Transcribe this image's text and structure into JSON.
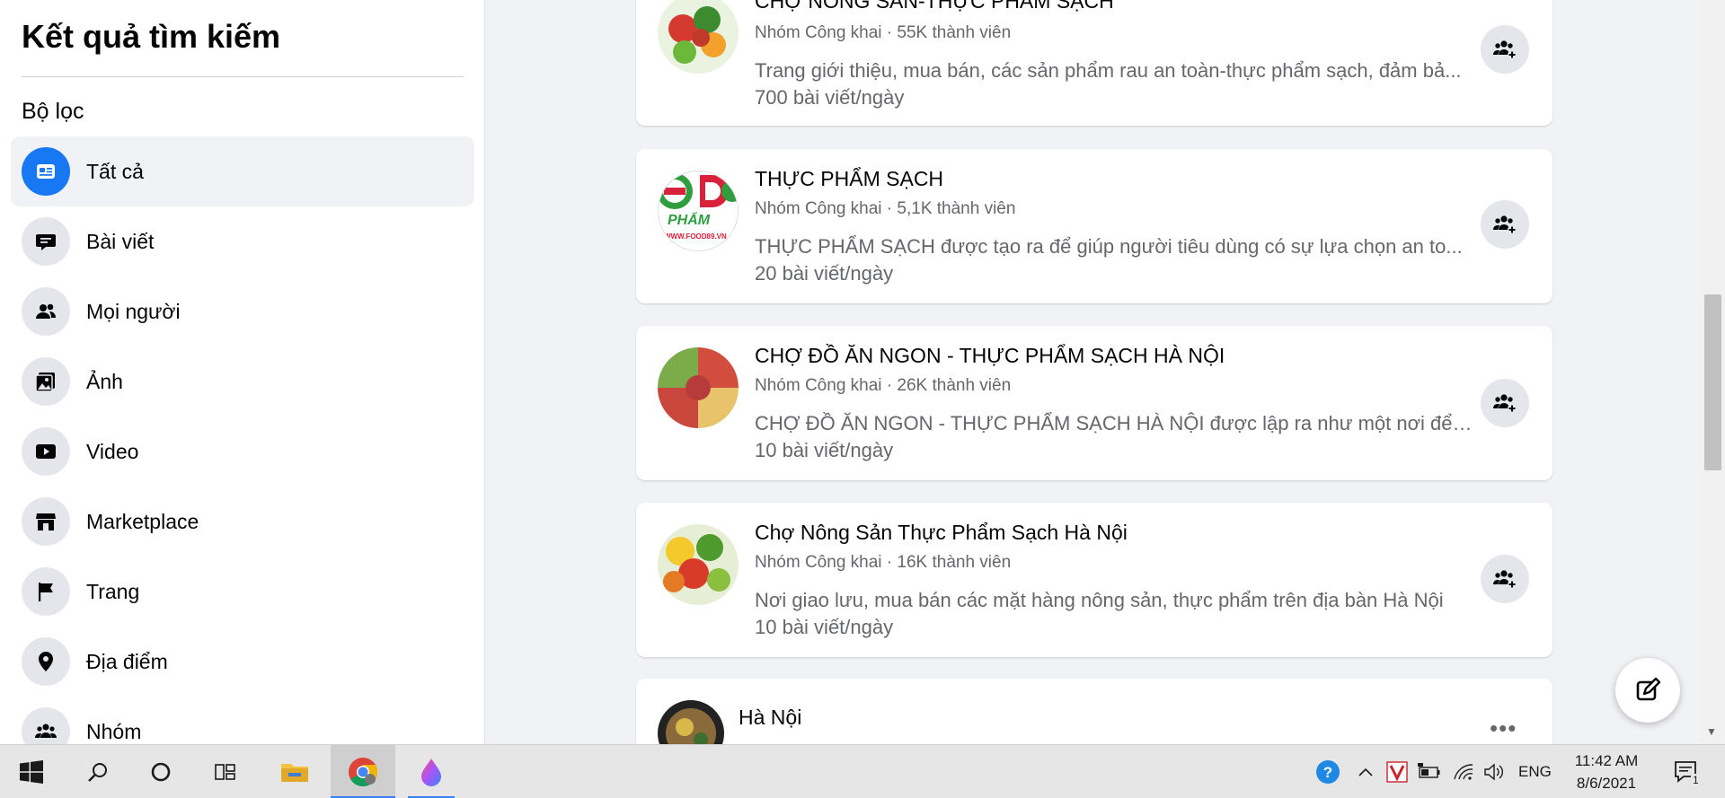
{
  "sidebar": {
    "title": "Kết quả tìm kiếm",
    "filter_label": "Bộ lọc",
    "items": [
      {
        "label": "Tất cả",
        "icon": "feed-icon",
        "active": true
      },
      {
        "label": "Bài viết",
        "icon": "post-icon",
        "active": false
      },
      {
        "label": "Mọi người",
        "icon": "people-icon",
        "active": false
      },
      {
        "label": "Ảnh",
        "icon": "photo-icon",
        "active": false
      },
      {
        "label": "Video",
        "icon": "video-icon",
        "active": false
      },
      {
        "label": "Marketplace",
        "icon": "store-icon",
        "active": false
      },
      {
        "label": "Trang",
        "icon": "flag-icon",
        "active": false
      },
      {
        "label": "Địa điểm",
        "icon": "location-icon",
        "active": false
      },
      {
        "label": "Nhóm",
        "icon": "group-icon",
        "active": false
      }
    ]
  },
  "results": [
    {
      "title": "CHỢ NÔNG SẢN-THỰC PHẨM SẠCH",
      "meta": "Nhóm Công khai · 55K thành viên",
      "description": "Trang giới thiệu, mua bán, các sản phẩm rau an toàn-thực phẩm sạch, đảm bả...",
      "rate": "700 bài viết/ngày"
    },
    {
      "title": "THỰC PHẨM SẠCH",
      "meta": "Nhóm Công khai · 5,1K thành viên",
      "description": "THỰC PHẨM SẠCH được tạo ra để giúp người tiêu dùng có sự lựa chọn an to...",
      "rate": "20 bài viết/ngày",
      "avatar_text": "PHẨM",
      "avatar_url_text": "WWW.FOOD89.VN"
    },
    {
      "title": "CHỢ ĐỒ ĂN NGON - THỰC PHẨM SẠCH HÀ NỘI",
      "meta": "Nhóm Công khai · 26K thành viên",
      "description": "CHỢ ĐỒ ĂN NGON - THỰC PHẨM SẠCH HÀ NỘI được lập ra như một nơi để ...",
      "rate": "10 bài viết/ngày"
    },
    {
      "title": "Chợ Nông Sản Thực Phẩm Sạch Hà Nội",
      "meta": "Nhóm Công khai · 16K thành viên",
      "description": "Nơi giao lưu, mua bán các mặt hàng nông sản, thực phẩm trên địa bàn Hà Nội",
      "rate": "10 bài viết/ngày"
    },
    {
      "title": "Hà Nội",
      "more_label": "•••"
    }
  ],
  "taskbar": {
    "language": "ENG",
    "time": "11:42 AM",
    "date": "8/6/2021",
    "notification_count": "1"
  },
  "colors": {
    "accent": "#1877f2",
    "icon_bg": "#e4e6eb",
    "page_bg": "#f0f2f5",
    "secondary_text": "#65676b"
  }
}
